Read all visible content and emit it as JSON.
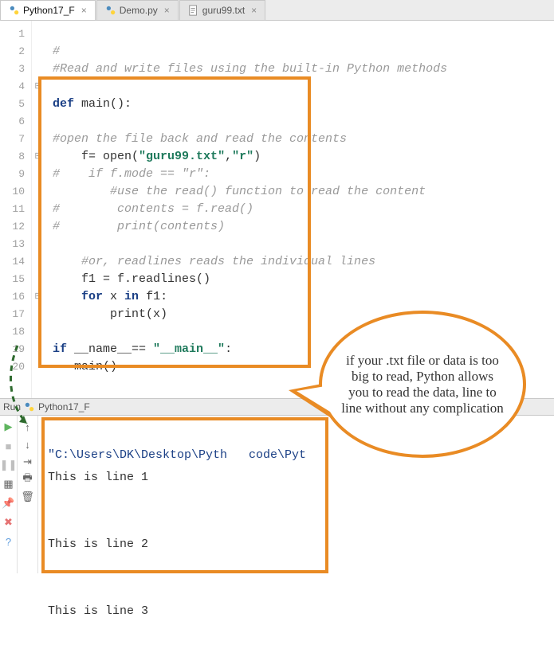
{
  "tabs": [
    {
      "label": "Python17_F",
      "type": "py",
      "active": true
    },
    {
      "label": "Demo.py",
      "type": "py",
      "active": false
    },
    {
      "label": "guru99.txt",
      "type": "txt",
      "active": false
    }
  ],
  "line_numbers": [
    "1",
    "2",
    "3",
    "4",
    "5",
    "6",
    "7",
    "8",
    "9",
    "10",
    "11",
    "12",
    "13",
    "14",
    "15",
    "16",
    "17",
    "18",
    "19",
    "20"
  ],
  "code": {
    "l1": "#",
    "l2": "#Read and write files using the built-in Python methods",
    "l3": "",
    "l4_kw": "def",
    "l4_rest": " main():",
    "l5": "",
    "l6": "#open the file back and read the contents",
    "l7_a": "    f= ",
    "l7_open": "open",
    "l7_p1": "(",
    "l7_s1": "\"guru99.txt\"",
    "l7_c": ",",
    "l7_s2": "\"r\"",
    "l7_p2": ")",
    "l8": "#    if f.mode == \"r\":",
    "l9": "        #use the read() function to read the content",
    "l10": "#        contents = f.read()",
    "l11": "#        print(contents)",
    "l12": "",
    "l13": "    #or, readlines reads the individual lines",
    "l14": "    f1 = f.readlines()",
    "l15_a": "    ",
    "l15_for": "for",
    "l15_b": " x ",
    "l15_in": "in",
    "l15_c": " f1:",
    "l16_a": "        ",
    "l16_print": "print",
    "l16_b": "(x)",
    "l17": "",
    "l18_if": "if",
    "l18_a": " __name__== ",
    "l18_s": "\"__main__\"",
    "l18_b": ":",
    "l19": "   main()"
  },
  "callout_text": "if your .txt file or data is too big to read, Python allows you to read the data, line to line without any complication",
  "run": {
    "label": "Run",
    "target": "Python17_F"
  },
  "console": {
    "cmd": "\"C:\\Users\\DK\\Desktop\\Pyth   code\\Pyt",
    "out1": "This is line 1",
    "out2": "This is line 2",
    "out3": "This is line 3"
  },
  "colors": {
    "accent": "#e98b24"
  }
}
